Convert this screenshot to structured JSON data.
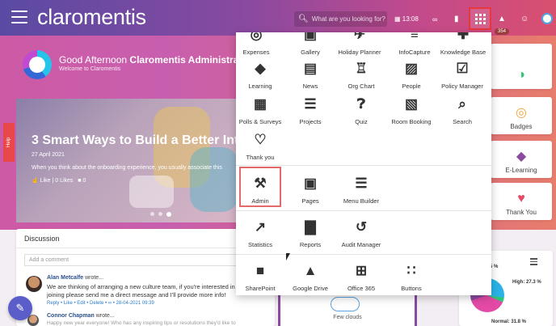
{
  "topbar": {
    "logo": "claromentis",
    "search_placeholder": "What are you looking for?",
    "time": "13:08",
    "notifications_count": "354",
    "colors": {
      "gradient_start": "#5a4aa3",
      "gradient_end": "#d9506f",
      "apps_highlight": "#e8373d"
    }
  },
  "welcome": {
    "greeting_prefix": "Good Afternoon",
    "greeting_name": "Claromentis Administrator",
    "subtitle": "Welcome to Claromentis"
  },
  "banner": {
    "title": "3 Smart Ways to Build a Better Intranet",
    "date": "27 April 2021",
    "excerpt": "When you think about the onboarding experience, you usually associate this",
    "like_label": "Like",
    "likes_count": "0 Likes",
    "comments_count": "0"
  },
  "help_tab": "Help",
  "right_cards": {
    "badges": "Badges",
    "elearning": "E-Learning",
    "thankyou": "Thank You"
  },
  "discussion": {
    "title": "Discussion",
    "comment_placeholder": "Add a comment",
    "posts": [
      {
        "author": "Alan Metcalfe",
        "action": "wrote...",
        "text": "We are thinking of arranging a new culture team, if you're interested in joining please send me a direct message and I'll provide more info!",
        "meta": "Reply • Like • Edit • Delete • ∞ • 28-04-2021 09:39"
      },
      {
        "author": "Connor Chapman",
        "action": "wrote...",
        "text": "Happy new year everyone! Who has any inspiring tips or resolutions they'd like to"
      }
    ]
  },
  "weather": {
    "label": "Few clouds"
  },
  "priority_chart": {
    "urgent_label": "Urgent: 4.5 %",
    "high_label": "High: 27.3 %",
    "normal_label": "Normal: 31.8 %"
  },
  "apps_menu": {
    "row1": [
      "Expenses",
      "Gallery",
      "Holiday Planner",
      "InfoCapture",
      "Knowledge Base"
    ],
    "row2": [
      "Learning",
      "News",
      "Org Chart",
      "People",
      "Policy Manager"
    ],
    "row3": [
      "Polls & Surveys",
      "Projects",
      "Quiz",
      "Room Booking",
      "Search"
    ],
    "row4": [
      "Thank you"
    ],
    "admin_row": [
      "Admin",
      "Pages",
      "Menu Builder"
    ],
    "stats_row": [
      "Statistics",
      "Reports",
      "Audit Manager"
    ],
    "integrations_row": [
      "SharePoint",
      "Google Drive",
      "Office 365",
      "Buttons"
    ]
  }
}
